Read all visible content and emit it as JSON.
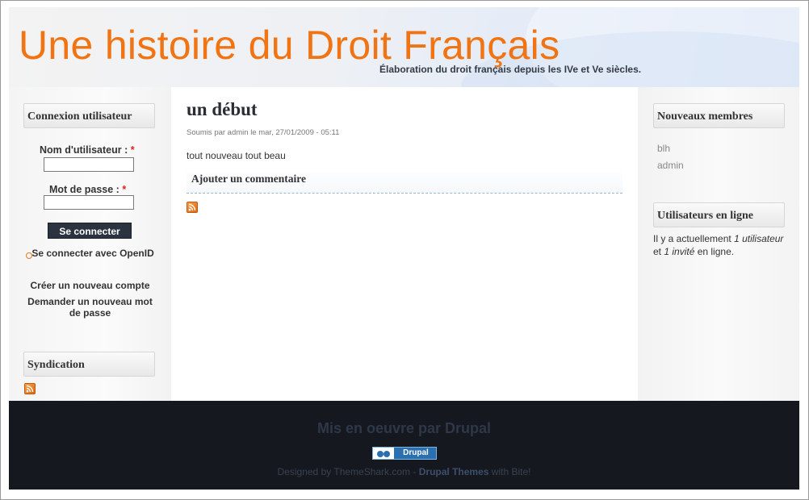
{
  "header": {
    "site_name": "Une histoire du Droit Français",
    "slogan": "Élaboration du droit français depuis les IVe et Ve siècles."
  },
  "login_block": {
    "title": "Connexion utilisateur",
    "username_label": "Nom d'utilisateur :",
    "password_label": "Mot de passe :",
    "required_mark": "*",
    "submit_label": "Se connecter",
    "openid_link": "Se connecter avec OpenID",
    "create_account": "Créer un nouveau compte",
    "request_password_line1": "Demander un nouveau mot",
    "request_password_line2": "de passe"
  },
  "syndication_block": {
    "title": "Syndication",
    "feed_icon": "rss-icon"
  },
  "node": {
    "title": "un début",
    "submitted": "Soumis par admin le mar, 27/01/2009 - 05:11",
    "body": "tout nouveau tout beau",
    "add_comment": "Ajouter un commentaire",
    "feed_icon": "rss-icon"
  },
  "new_members_block": {
    "title": "Nouveaux membres",
    "members": [
      "blh",
      "admin"
    ]
  },
  "online_block": {
    "title": "Utilisateurs en ligne",
    "text_prefix": "Il y a actuellement ",
    "users_count": "1 utilisateur",
    "text_middle": " et ",
    "guests_count": "1 invité",
    "text_suffix": " en ligne."
  },
  "footer": {
    "powered_by": "Mis en oeuvre par Drupal",
    "badge_label": "Drupal",
    "credit_prefix": "Designed by ThemeShark.com - ",
    "credit_link": "Drupal Themes",
    "credit_suffix": " with Bite!"
  },
  "colors": {
    "title_orange": "#f07414",
    "footer_bg": "#15181e",
    "button_bg": "#2b3340"
  }
}
